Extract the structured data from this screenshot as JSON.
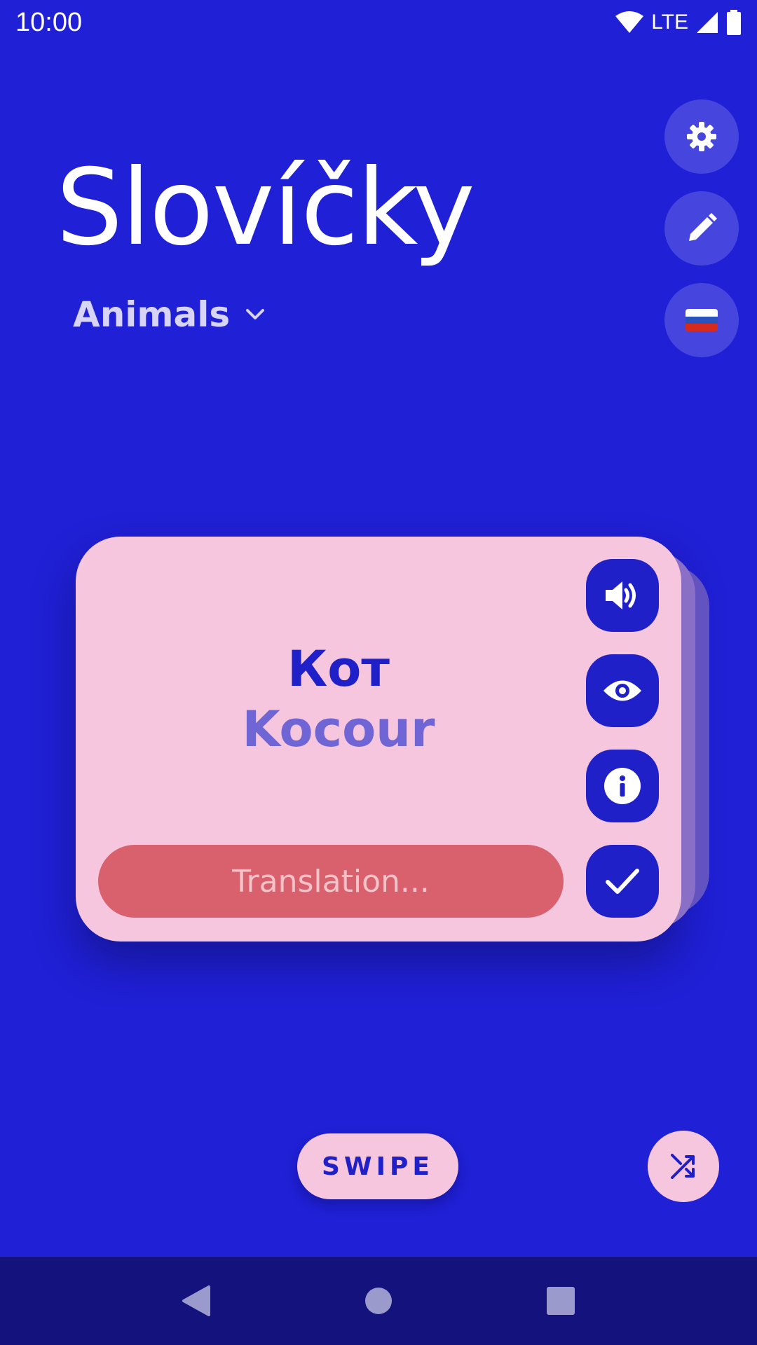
{
  "status_bar": {
    "time": "10:00",
    "network": "LTE",
    "icons": [
      "wifi-icon",
      "cell-signal-icon",
      "battery-icon"
    ]
  },
  "header": {
    "title": "Slovíčky",
    "category": "Animals"
  },
  "side_buttons": [
    {
      "name": "settings",
      "icon": "gear-icon"
    },
    {
      "name": "edit",
      "icon": "pencil-icon"
    },
    {
      "name": "language",
      "icon": "russian-flag-icon"
    }
  ],
  "card": {
    "word": "Кот",
    "translation_shown": "Kocour",
    "translation_input_placeholder": "Translation...",
    "actions": [
      {
        "name": "pronounce",
        "icon": "speaker-icon"
      },
      {
        "name": "reveal",
        "icon": "eye-icon"
      },
      {
        "name": "info",
        "icon": "info-icon"
      },
      {
        "name": "check",
        "icon": "check-icon"
      }
    ]
  },
  "bottom": {
    "swipe_label": "SWIPE",
    "shuffle_icon": "shuffle-icon"
  },
  "nav_bar": {
    "icons": [
      "back-icon",
      "home-icon",
      "recents-icon"
    ]
  },
  "colors": {
    "background": "#2020d6",
    "card": "#f6c5de",
    "accent": "#2020c8",
    "input": "#d9616e",
    "nav_bar": "#14137d"
  }
}
